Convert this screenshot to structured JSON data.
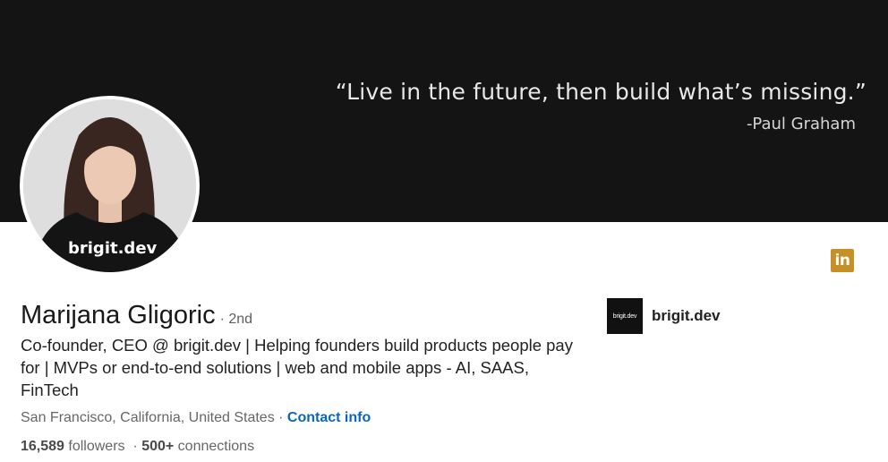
{
  "banner": {
    "quote": "“Live in the future, then build  what’s missing.”",
    "author": "-Paul Graham"
  },
  "avatar": {
    "shirt_text": "brigit.dev"
  },
  "profile": {
    "name": "Marijana Gligoric",
    "degree": "· 2nd",
    "headline": "Co-founder, CEO @ brigit.dev | Helping founders build products people pay for | MVPs or end-to-end solutions | web and mobile apps - AI, SAAS, FinTech",
    "location": "San Francisco, California, United States",
    "location_separator": " · ",
    "contact_label": "Contact info",
    "followers_count": "16,589",
    "followers_label": " followers",
    "stats_separator": "  · ",
    "connections_count": "500+",
    "connections_label": " connections"
  },
  "company": {
    "logo_text": "brigit.dev",
    "name": "brigit.dev"
  },
  "linkedin_badge": {
    "text": "in",
    "color": "#c69026",
    "icon": "linkedin-icon"
  },
  "colors": {
    "banner_bg": "#141414",
    "link": "#0a66c2"
  }
}
